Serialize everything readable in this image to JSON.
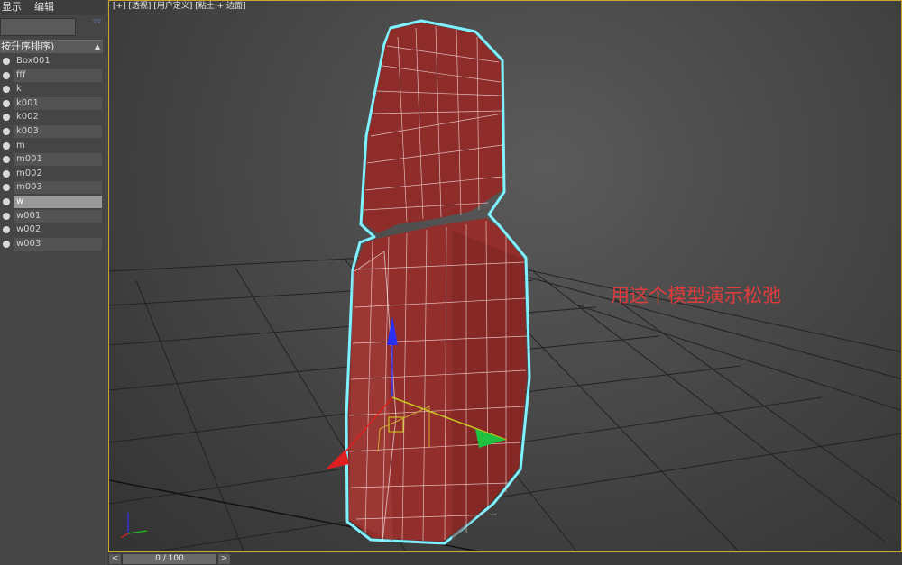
{
  "menu": {
    "display": "显示",
    "edit": "编辑"
  },
  "explorer": {
    "filter_icon": "funnel-icon",
    "sort_label": "按升序排序)",
    "sort_arrow": "▲",
    "objects": [
      "Box001",
      "fff",
      "k",
      "k001",
      "k002",
      "k003",
      "m",
      "m001",
      "m002",
      "m003",
      "w",
      "w001",
      "w002",
      "w003"
    ],
    "selected": "w"
  },
  "viewport": {
    "label": "[+] [透视] [用户定义] [粘土 + 边面]",
    "annotation": "用这个模型演示松弛",
    "border_color": "#c9a633",
    "model_color": "#8e2c2a",
    "selection_outline_color": "#7ff1ff"
  },
  "time_slider": {
    "prev": "<",
    "position": "0 / 100",
    "next": ">"
  }
}
